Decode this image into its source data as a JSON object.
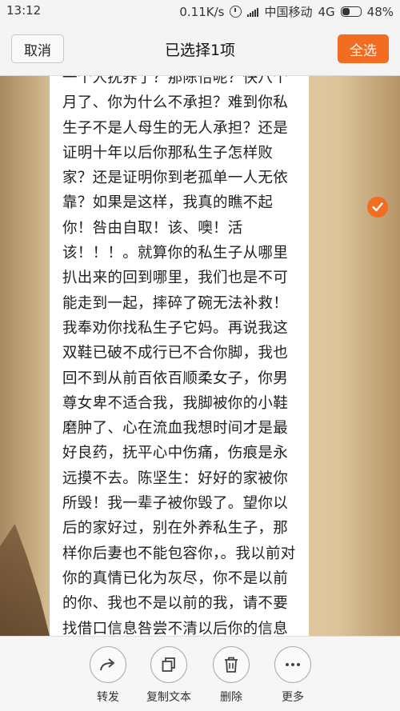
{
  "status_bar": {
    "time": "13:12",
    "network_speed": "0.11K/s",
    "carrier": "中国移动",
    "network_type": "4G",
    "battery": "48%",
    "battery_level": 0.48
  },
  "header": {
    "cancel_label": "取消",
    "title": "已选择1项",
    "select_all_label": "全选",
    "accent_color": "#f26c22"
  },
  "message": {
    "text": "一个人抚养了？那陈恰呢？快八个月了、你为什么不承担？难到你私生子不是人母生的无人承担？还是证明十年以后你那私生子怎样败家？还是证明你到老孤单一人无依靠？如果是这样，我真的瞧不起你！咎由自取！该、噢！活该！！！。就算你的私生子从哪里扒出来的回到哪里，我们也是不可能走到一起，摔碎了碗无法补救！我奉劝你找私生子它妈。再说我这双鞋已破不成行已不合你脚，我也回不到从前百依百顺柔女子，你男尊女卑不适合我，我脚被你的小鞋磨肿了、心在流血我想时间才是最好良药，抚平心中伤痛，伤痕是永远摸不去。陈坚生：好好的家被你所毁！我一辈子被你毁了。望你以后的家好过，别在外养私生子，那样你后妻也不能包容你，。我以前对你的真情已化为灰尽，你不是以前的你、我也不是以前的我，请不要找借口信息咎尝不清以后你的信息对我来说会石沉大海！，彼此留个好印象！相见不如怀念吧！！！",
    "selected": true
  },
  "actions": [
    {
      "label": "转发",
      "icon": "forward-icon"
    },
    {
      "label": "复制文本",
      "icon": "copy-icon"
    },
    {
      "label": "删除",
      "icon": "trash-icon"
    },
    {
      "label": "更多",
      "icon": "more-icon"
    }
  ]
}
